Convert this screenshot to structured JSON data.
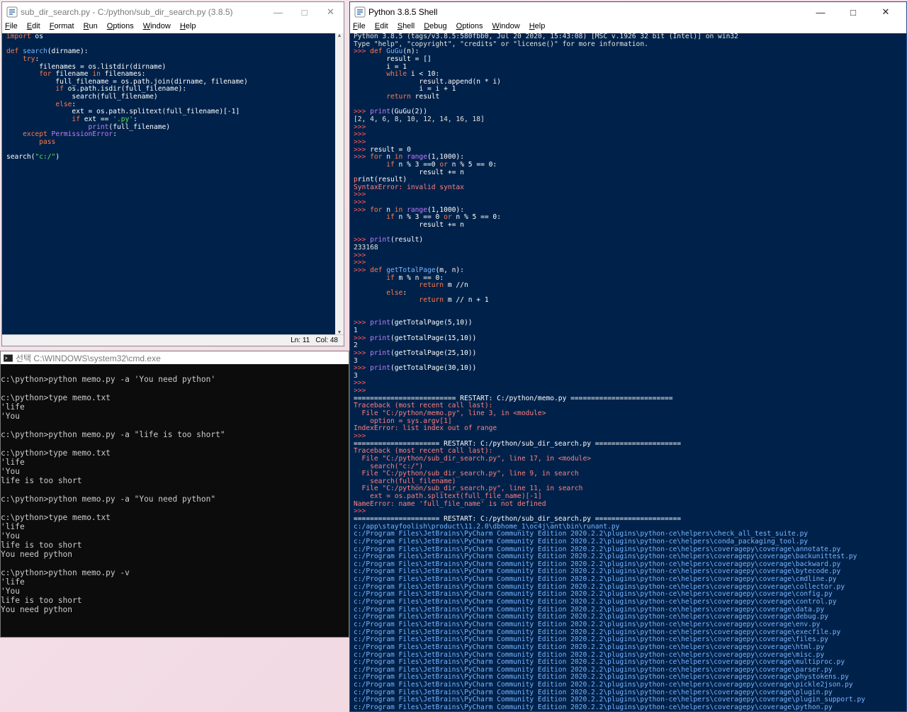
{
  "editor": {
    "title": "sub_dir_search.py - C:/python/sub_dir_search.py (3.8.5)",
    "menu": [
      "File",
      "Edit",
      "Format",
      "Run",
      "Options",
      "Window",
      "Help"
    ],
    "status_ln": "Ln: 11",
    "status_col": "Col: 48",
    "code": [
      [
        [
          "kw",
          "import"
        ],
        [
          "n",
          " os"
        ]
      ],
      [
        [
          "n",
          ""
        ]
      ],
      [
        [
          "kw",
          "def"
        ],
        [
          "n",
          " "
        ],
        [
          "def",
          "search"
        ],
        [
          "n",
          "(dirname):"
        ]
      ],
      [
        [
          "n",
          "    "
        ],
        [
          "kw",
          "try"
        ],
        [
          "n",
          ":"
        ]
      ],
      [
        [
          "n",
          "        filenames = os.listdir(dirname)"
        ]
      ],
      [
        [
          "n",
          "        "
        ],
        [
          "kw",
          "for"
        ],
        [
          "n",
          " filename "
        ],
        [
          "kw",
          "in"
        ],
        [
          "n",
          " filenames:"
        ]
      ],
      [
        [
          "n",
          "            full_filename = os.path.join(dirname, filename)"
        ]
      ],
      [
        [
          "n",
          "            "
        ],
        [
          "kw",
          "if"
        ],
        [
          "n",
          " os.path.isdir(full_filename):"
        ]
      ],
      [
        [
          "n",
          "                search(full_filename)"
        ]
      ],
      [
        [
          "n",
          "            "
        ],
        [
          "kw",
          "else"
        ],
        [
          "n",
          ":"
        ]
      ],
      [
        [
          "n",
          "                ext = os.path.splitext(full_filename)[-1]"
        ]
      ],
      [
        [
          "n",
          "                "
        ],
        [
          "kw",
          "if"
        ],
        [
          "n",
          " ext == "
        ],
        [
          "str",
          "'.py'"
        ],
        [
          "n",
          ":"
        ]
      ],
      [
        [
          "n",
          "                    "
        ],
        [
          "bi",
          "print"
        ],
        [
          "n",
          "(full_filename)"
        ]
      ],
      [
        [
          "n",
          "    "
        ],
        [
          "kw",
          "except"
        ],
        [
          "n",
          " "
        ],
        [
          "bi",
          "PermissionError"
        ],
        [
          "n",
          ":"
        ]
      ],
      [
        [
          "n",
          "        "
        ],
        [
          "kw",
          "pass"
        ]
      ],
      [
        [
          "n",
          ""
        ]
      ],
      [
        [
          "n",
          "search("
        ],
        [
          "str",
          "\"c:/\""
        ],
        [
          "n",
          ")"
        ]
      ]
    ]
  },
  "cmd": {
    "title": "선택 C:\\WINDOWS\\system32\\cmd.exe",
    "lines": [
      "",
      "c:\\python>python memo.py -a 'You need python'",
      "",
      "c:\\python>type memo.txt",
      "'life",
      "'You",
      "",
      "c:\\python>python memo.py -a \"life is too short\"",
      "",
      "c:\\python>type memo.txt",
      "'life",
      "'You",
      "life is too short",
      "",
      "c:\\python>python memo.py -a \"You need python\"",
      "",
      "c:\\python>type memo.txt",
      "'life",
      "'You",
      "life is too short",
      "You need python",
      "",
      "c:\\python>python memo.py -v",
      "'life",
      "'You",
      "life is too short",
      "You need python"
    ]
  },
  "shell": {
    "title": "Python 3.8.5 Shell",
    "menu": [
      "File",
      "Edit",
      "Shell",
      "Debug",
      "Options",
      "Window",
      "Help"
    ],
    "lines": [
      [
        [
          "sys",
          "Python 3.8.5 (tags/v3.8.5:580fbb0, Jul 20 2020, 15:43:08) [MSC v.1926 32 bit (Intel)] on win32"
        ]
      ],
      [
        [
          "sys",
          "Type \"help\", \"copyright\", \"credits\" or \"license()\" for more information."
        ]
      ],
      [
        [
          "prompt",
          ">>> "
        ],
        [
          "kw",
          "def"
        ],
        [
          "n",
          " "
        ],
        [
          "def",
          "GuGu"
        ],
        [
          "n",
          "(n):"
        ]
      ],
      [
        [
          "n",
          "        result = []"
        ]
      ],
      [
        [
          "n",
          "        i = 1"
        ]
      ],
      [
        [
          "n",
          "        "
        ],
        [
          "kw",
          "while"
        ],
        [
          "n",
          " i < 10:"
        ]
      ],
      [
        [
          "n",
          "                result.append(n * i)"
        ]
      ],
      [
        [
          "n",
          "                i = i + 1"
        ]
      ],
      [
        [
          "n",
          "        "
        ],
        [
          "kw",
          "return"
        ],
        [
          "n",
          " result"
        ]
      ],
      [
        [
          "n",
          ""
        ]
      ],
      [
        [
          "prompt",
          ">>> "
        ],
        [
          "bi",
          "print"
        ],
        [
          "n",
          "(GuGu(2))"
        ]
      ],
      [
        [
          "sys",
          "[2, 4, 6, 8, 10, 12, 14, 16, 18]"
        ]
      ],
      [
        [
          "prompt",
          ">>> "
        ]
      ],
      [
        [
          "prompt",
          ">>> "
        ]
      ],
      [
        [
          "prompt",
          ">>> "
        ]
      ],
      [
        [
          "prompt",
          ">>> "
        ],
        [
          "n",
          "result = 0"
        ]
      ],
      [
        [
          "prompt",
          ">>> "
        ],
        [
          "kw",
          "for"
        ],
        [
          "n",
          " n "
        ],
        [
          "kw",
          "in"
        ],
        [
          "n",
          " "
        ],
        [
          "bi",
          "range"
        ],
        [
          "n",
          "(1,1000):"
        ]
      ],
      [
        [
          "n",
          "        "
        ],
        [
          "kw",
          "if"
        ],
        [
          "n",
          " n % 3 ==0 "
        ],
        [
          "kw",
          "or"
        ],
        [
          "n",
          " n % 5 == 0:"
        ]
      ],
      [
        [
          "n",
          "                result += n"
        ]
      ],
      [
        [
          "err",
          "p"
        ],
        [
          "n",
          "rint(result)"
        ]
      ],
      [
        [
          "err",
          "SyntaxError: invalid syntax"
        ]
      ],
      [
        [
          "prompt",
          ">>> "
        ]
      ],
      [
        [
          "prompt",
          ">>> "
        ]
      ],
      [
        [
          "prompt",
          ">>> "
        ],
        [
          "kw",
          "for"
        ],
        [
          "n",
          " n "
        ],
        [
          "kw",
          "in"
        ],
        [
          "n",
          " "
        ],
        [
          "bi",
          "range"
        ],
        [
          "n",
          "(1,1000):"
        ]
      ],
      [
        [
          "n",
          "        "
        ],
        [
          "kw",
          "if"
        ],
        [
          "n",
          " n % 3 == 0 "
        ],
        [
          "kw",
          "or"
        ],
        [
          "n",
          " n % 5 == 0:"
        ]
      ],
      [
        [
          "n",
          "                result += n"
        ]
      ],
      [
        [
          "n",
          ""
        ]
      ],
      [
        [
          "prompt",
          ">>> "
        ],
        [
          "bi",
          "print"
        ],
        [
          "n",
          "(result)"
        ]
      ],
      [
        [
          "sys",
          "233168"
        ]
      ],
      [
        [
          "prompt",
          ">>> "
        ]
      ],
      [
        [
          "prompt",
          ">>> "
        ]
      ],
      [
        [
          "prompt",
          ">>> "
        ],
        [
          "kw",
          "def"
        ],
        [
          "n",
          " "
        ],
        [
          "def",
          "getTotalPage"
        ],
        [
          "n",
          "(m, n):"
        ]
      ],
      [
        [
          "n",
          "        "
        ],
        [
          "kw",
          "if"
        ],
        [
          "n",
          " m % n == 0:"
        ]
      ],
      [
        [
          "n",
          "                "
        ],
        [
          "kw",
          "return"
        ],
        [
          "n",
          " m //n"
        ]
      ],
      [
        [
          "n",
          "        "
        ],
        [
          "kw",
          "else"
        ],
        [
          "n",
          ":"
        ]
      ],
      [
        [
          "n",
          "                "
        ],
        [
          "kw",
          "return"
        ],
        [
          "n",
          " m // n + 1"
        ]
      ],
      [
        [
          "n",
          ""
        ]
      ],
      [
        [
          "n",
          ""
        ]
      ],
      [
        [
          "prompt",
          ">>> "
        ],
        [
          "bi",
          "print"
        ],
        [
          "n",
          "(getTotalPage(5,10))"
        ]
      ],
      [
        [
          "sys",
          "1"
        ]
      ],
      [
        [
          "prompt",
          ">>> "
        ],
        [
          "bi",
          "print"
        ],
        [
          "n",
          "(getTotalPage(15,10))"
        ]
      ],
      [
        [
          "sys",
          "2"
        ]
      ],
      [
        [
          "prompt",
          ">>> "
        ],
        [
          "bi",
          "print"
        ],
        [
          "n",
          "(getTotalPage(25,10))"
        ]
      ],
      [
        [
          "sys",
          "3"
        ]
      ],
      [
        [
          "prompt",
          ">>> "
        ],
        [
          "bi",
          "print"
        ],
        [
          "n",
          "(getTotalPage(30,10))"
        ]
      ],
      [
        [
          "sys",
          "3"
        ]
      ],
      [
        [
          "prompt",
          ">>> "
        ]
      ],
      [
        [
          "prompt",
          ">>> "
        ]
      ],
      [
        [
          "n",
          "========================= RESTART: C:/python/memo.py ========================="
        ]
      ],
      [
        [
          "err",
          "Traceback (most recent call last):"
        ]
      ],
      [
        [
          "err",
          "  File \"C:/python/memo.py\", line 3, in <module>"
        ]
      ],
      [
        [
          "err",
          "    option = sys.argv[1]"
        ]
      ],
      [
        [
          "err",
          "IndexError: list index out of range"
        ]
      ],
      [
        [
          "prompt",
          ">>> "
        ]
      ],
      [
        [
          "n",
          "===================== RESTART: C:/python/sub_dir_search.py ====================="
        ]
      ],
      [
        [
          "err",
          "Traceback (most recent call last):"
        ]
      ],
      [
        [
          "err",
          "  File \"C:/python/sub_dir_search.py\", line 17, in <module>"
        ]
      ],
      [
        [
          "err",
          "    search(\"c:/\")"
        ]
      ],
      [
        [
          "err",
          "  File \"C:/python/sub_dir_search.py\", line 9, in search"
        ]
      ],
      [
        [
          "err",
          "    search(full_filename)"
        ]
      ],
      [
        [
          "err",
          "  File \"C:/python/sub_dir_search.py\", line 11, in search"
        ]
      ],
      [
        [
          "err",
          "    ext = os.path.splitext(full_file_name)[-1]"
        ]
      ],
      [
        [
          "err",
          "NameError: name 'full_file_name' is not defined"
        ]
      ],
      [
        [
          "prompt",
          ">>> "
        ]
      ],
      [
        [
          "n",
          "===================== RESTART: C:/python/sub_dir_search.py ====================="
        ]
      ],
      [
        [
          "def",
          "c:/app\\stayfoolish\\product\\11.2.0\\dbhome_1\\oc4j\\ant\\bin\\runant.py"
        ]
      ],
      [
        [
          "def",
          "c:/Program Files\\JetBrains\\PyCharm Community Edition 2020.2.2\\plugins\\python-ce\\helpers\\check_all_test_suite.py"
        ]
      ],
      [
        [
          "def",
          "c:/Program Files\\JetBrains\\PyCharm Community Edition 2020.2.2\\plugins\\python-ce\\helpers\\conda_packaging_tool.py"
        ]
      ],
      [
        [
          "def",
          "c:/Program Files\\JetBrains\\PyCharm Community Edition 2020.2.2\\plugins\\python-ce\\helpers\\coveragepy\\coverage\\annotate.py"
        ]
      ],
      [
        [
          "def",
          "c:/Program Files\\JetBrains\\PyCharm Community Edition 2020.2.2\\plugins\\python-ce\\helpers\\coveragepy\\coverage\\backunittest.py"
        ]
      ],
      [
        [
          "def",
          "c:/Program Files\\JetBrains\\PyCharm Community Edition 2020.2.2\\plugins\\python-ce\\helpers\\coveragepy\\coverage\\backward.py"
        ]
      ],
      [
        [
          "def",
          "c:/Program Files\\JetBrains\\PyCharm Community Edition 2020.2.2\\plugins\\python-ce\\helpers\\coveragepy\\coverage\\bytecode.py"
        ]
      ],
      [
        [
          "def",
          "c:/Program Files\\JetBrains\\PyCharm Community Edition 2020.2.2\\plugins\\python-ce\\helpers\\coveragepy\\coverage\\cmdline.py"
        ]
      ],
      [
        [
          "def",
          "c:/Program Files\\JetBrains\\PyCharm Community Edition 2020.2.2\\plugins\\python-ce\\helpers\\coveragepy\\coverage\\collector.py"
        ]
      ],
      [
        [
          "def",
          "c:/Program Files\\JetBrains\\PyCharm Community Edition 2020.2.2\\plugins\\python-ce\\helpers\\coveragepy\\coverage\\config.py"
        ]
      ],
      [
        [
          "def",
          "c:/Program Files\\JetBrains\\PyCharm Community Edition 2020.2.2\\plugins\\python-ce\\helpers\\coveragepy\\coverage\\control.py"
        ]
      ],
      [
        [
          "def",
          "c:/Program Files\\JetBrains\\PyCharm Community Edition 2020.2.2\\plugins\\python-ce\\helpers\\coveragepy\\coverage\\data.py"
        ]
      ],
      [
        [
          "def",
          "c:/Program Files\\JetBrains\\PyCharm Community Edition 2020.2.2\\plugins\\python-ce\\helpers\\coveragepy\\coverage\\debug.py"
        ]
      ],
      [
        [
          "def",
          "c:/Program Files\\JetBrains\\PyCharm Community Edition 2020.2.2\\plugins\\python-ce\\helpers\\coveragepy\\coverage\\env.py"
        ]
      ],
      [
        [
          "def",
          "c:/Program Files\\JetBrains\\PyCharm Community Edition 2020.2.2\\plugins\\python-ce\\helpers\\coveragepy\\coverage\\execfile.py"
        ]
      ],
      [
        [
          "def",
          "c:/Program Files\\JetBrains\\PyCharm Community Edition 2020.2.2\\plugins\\python-ce\\helpers\\coveragepy\\coverage\\files.py"
        ]
      ],
      [
        [
          "def",
          "c:/Program Files\\JetBrains\\PyCharm Community Edition 2020.2.2\\plugins\\python-ce\\helpers\\coveragepy\\coverage\\html.py"
        ]
      ],
      [
        [
          "def",
          "c:/Program Files\\JetBrains\\PyCharm Community Edition 2020.2.2\\plugins\\python-ce\\helpers\\coveragepy\\coverage\\misc.py"
        ]
      ],
      [
        [
          "def",
          "c:/Program Files\\JetBrains\\PyCharm Community Edition 2020.2.2\\plugins\\python-ce\\helpers\\coveragepy\\coverage\\multiproc.py"
        ]
      ],
      [
        [
          "def",
          "c:/Program Files\\JetBrains\\PyCharm Community Edition 2020.2.2\\plugins\\python-ce\\helpers\\coveragepy\\coverage\\parser.py"
        ]
      ],
      [
        [
          "def",
          "c:/Program Files\\JetBrains\\PyCharm Community Edition 2020.2.2\\plugins\\python-ce\\helpers\\coveragepy\\coverage\\phystokens.py"
        ]
      ],
      [
        [
          "def",
          "c:/Program Files\\JetBrains\\PyCharm Community Edition 2020.2.2\\plugins\\python-ce\\helpers\\coveragepy\\coverage\\pickle2json.py"
        ]
      ],
      [
        [
          "def",
          "c:/Program Files\\JetBrains\\PyCharm Community Edition 2020.2.2\\plugins\\python-ce\\helpers\\coveragepy\\coverage\\plugin.py"
        ]
      ],
      [
        [
          "def",
          "c:/Program Files\\JetBrains\\PyCharm Community Edition 2020.2.2\\plugins\\python-ce\\helpers\\coveragepy\\coverage\\plugin_support.py"
        ]
      ],
      [
        [
          "def",
          "c:/Program Files\\JetBrains\\PyCharm Community Edition 2020.2.2\\plugins\\python-ce\\helpers\\coveragepy\\coverage\\python.py"
        ]
      ]
    ]
  },
  "colors": {
    "editor_bg": "#00224a",
    "keyword": "#ff7a4c",
    "builtin": "#c27cff",
    "string": "#5fe35f",
    "definition": "#7ab5ff",
    "error": "#ff8080"
  },
  "icons": {
    "minimize": "minimize-icon",
    "maximize": "maximize-icon",
    "close": "close-icon",
    "idle": "python-idle-icon",
    "cmd": "cmd-icon"
  }
}
